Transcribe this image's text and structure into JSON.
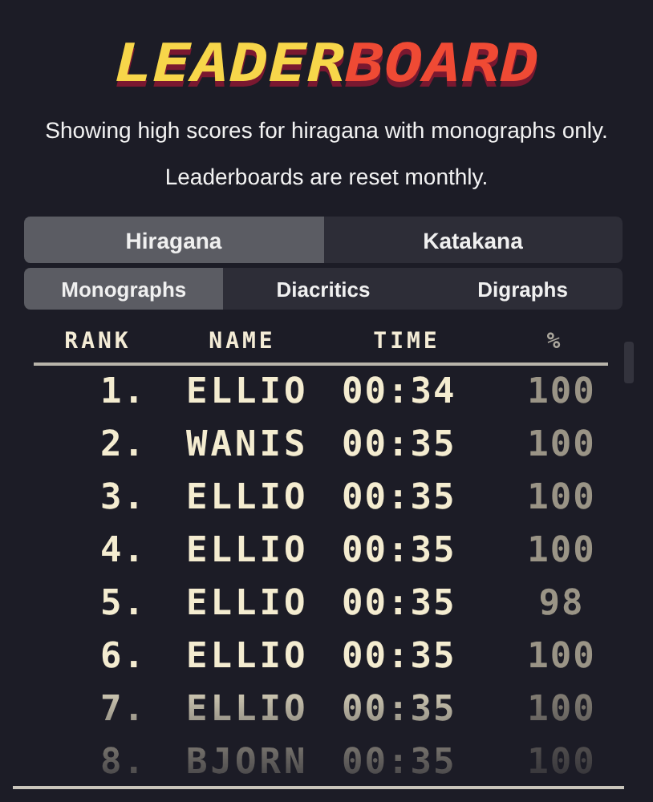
{
  "title": {
    "parts": [
      {
        "text": "LEADER",
        "color": "#f7d64a"
      },
      {
        "text": "BOARD",
        "color": "#ef4a34"
      }
    ]
  },
  "description": "Showing high scores for hiragana with monographs only.",
  "note": "Leaderboards are reset monthly.",
  "script_tabs": [
    {
      "label": "Hiragana",
      "selected": true
    },
    {
      "label": "Katakana",
      "selected": false
    }
  ],
  "set_tabs": [
    {
      "label": "Monographs",
      "selected": true
    },
    {
      "label": "Diacritics",
      "selected": false
    },
    {
      "label": "Digraphs",
      "selected": false
    }
  ],
  "table": {
    "columns": [
      "RANK",
      "NAME",
      "TIME",
      "%"
    ],
    "rows": [
      {
        "rank": "1.",
        "name": "ELLIO",
        "time": "00:34",
        "percent": "100"
      },
      {
        "rank": "2.",
        "name": "WANIS",
        "time": "00:35",
        "percent": "100"
      },
      {
        "rank": "3.",
        "name": "ELLIO",
        "time": "00:35",
        "percent": "100"
      },
      {
        "rank": "4.",
        "name": "ELLIO",
        "time": "00:35",
        "percent": "100"
      },
      {
        "rank": "5.",
        "name": "ELLIO",
        "time": "00:35",
        "percent": "98"
      },
      {
        "rank": "6.",
        "name": "ELLIO",
        "time": "00:35",
        "percent": "100"
      },
      {
        "rank": "7.",
        "name": "ELLIO",
        "time": "00:35",
        "percent": "100"
      },
      {
        "rank": "8.",
        "name": "BJORN",
        "time": "00:35",
        "percent": "100"
      }
    ]
  }
}
